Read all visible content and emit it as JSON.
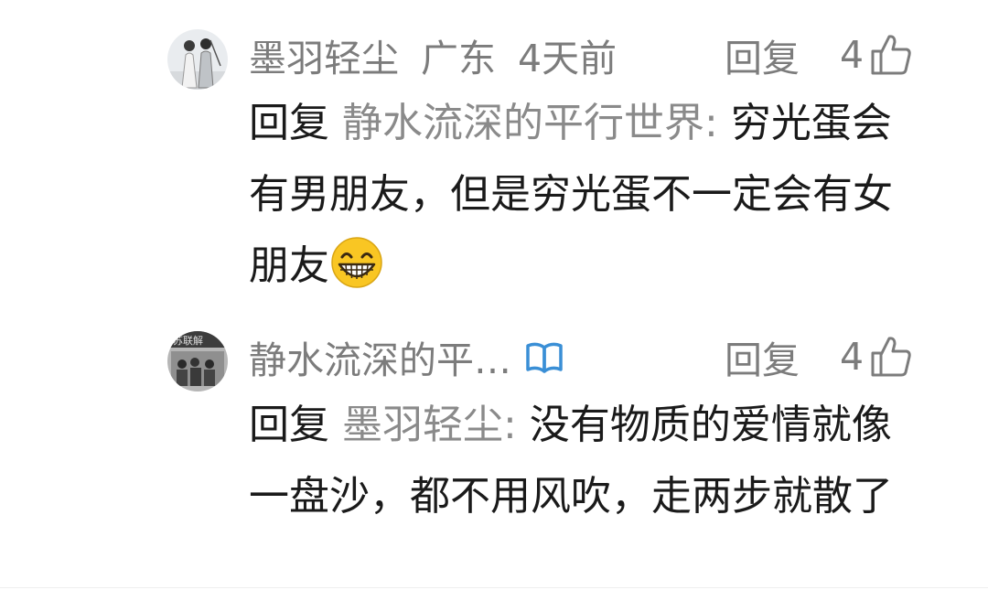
{
  "comments": [
    {
      "username": "墨羽轻尘",
      "location": "广东",
      "time": "4天前",
      "reply_label": "回复",
      "like_count": "4",
      "reply_prefix": "回复",
      "reply_target": "静水流深的平行世界:",
      "text": "穷光蛋会有男朋友，但是穷光蛋不一定会有女朋友",
      "emoji": "grinning-face-emoji"
    },
    {
      "username": "静水流深的平…",
      "badge": "verified-book-icon",
      "reply_label": "回复",
      "like_count": "4",
      "reply_prefix": "回复",
      "reply_target": "墨羽轻尘:",
      "text": "没有物质的爱情就像一盘沙，都不用风吹，走两步就散了"
    }
  ],
  "colors": {
    "meta_text": "#7c7c7c",
    "body_text": "#1a1a1a",
    "reply_target": "#8a8a8a",
    "badge_blue": "#3a8fd6",
    "emoji_yellow": "#f9c623"
  }
}
